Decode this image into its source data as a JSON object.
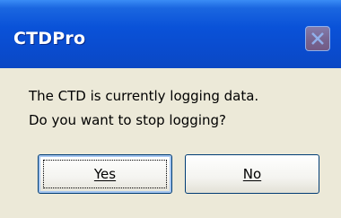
{
  "window": {
    "title": "CTDPro"
  },
  "message": {
    "line1": "The CTD is currently logging data.",
    "line2": "Do you want to stop logging?"
  },
  "buttons": {
    "yes_label": "Yes",
    "no_label": "No"
  },
  "icons": {
    "close": "close-icon"
  },
  "colors": {
    "titlebar": "#0a52d8",
    "dialog_background": "#ece9d8",
    "title_text": "#ffffff",
    "button_border": "#003c74"
  }
}
